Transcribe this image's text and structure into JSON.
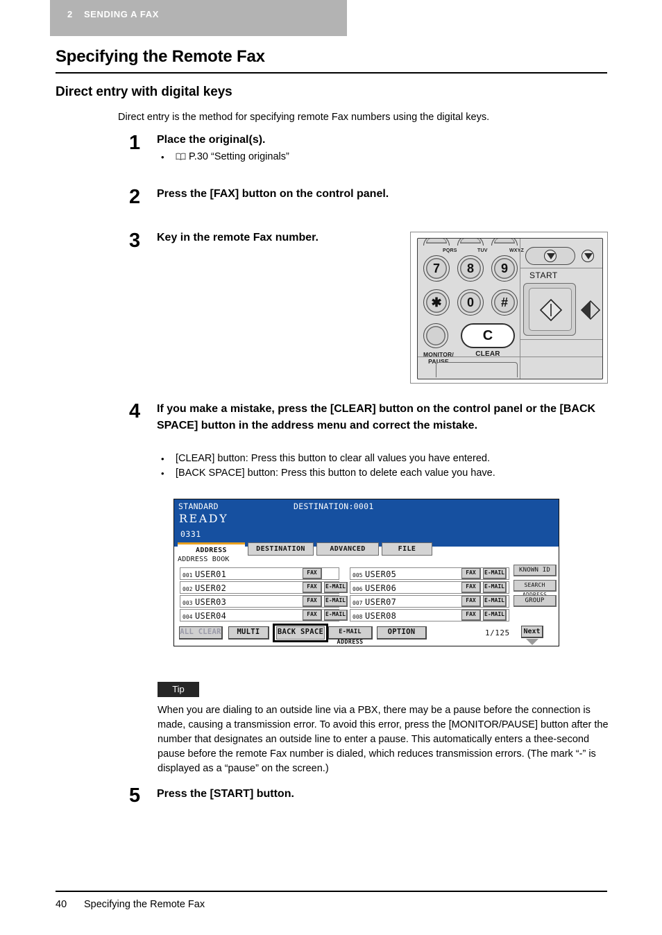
{
  "chapter": {
    "number": "2",
    "title": "SENDING A FAX"
  },
  "headings": {
    "h1": "Specifying the Remote Fax",
    "h2": "Direct entry with digital keys"
  },
  "intro": "Direct entry is the method for specifying remote Fax numbers using the digital keys.",
  "steps": [
    {
      "num": "1",
      "head": "Place the original(s).",
      "bullets": [
        "P.30 “Setting originals”"
      ]
    },
    {
      "num": "2",
      "head": "Press the [FAX] button on the control panel.",
      "bullets": []
    },
    {
      "num": "3",
      "head": "Key in the remote Fax number.",
      "bullets": []
    },
    {
      "num": "4",
      "head": "If you make a mistake, press the [CLEAR] button on the control panel or the [BACK SPACE] button in the address menu and correct the mistake.",
      "bullets": [
        "[CLEAR] button: Press this button to clear all values you have entered.",
        "[BACK SPACE] button: Press this button to delete each value you have."
      ]
    },
    {
      "num": "5",
      "head": "Press the [START] button.",
      "bullets": []
    }
  ],
  "control_panel": {
    "keys": [
      {
        "label": "7",
        "letters": "PQRS"
      },
      {
        "label": "8",
        "letters": "TUV"
      },
      {
        "label": "9",
        "letters": "WXYZ"
      },
      {
        "label": "✱",
        "letters": ""
      },
      {
        "label": "0",
        "letters": ""
      },
      {
        "label": "#",
        "letters": ""
      }
    ],
    "clear_key_label": "C",
    "clear_label": "CLEAR",
    "monitor_label_line1": "MONITOR/",
    "monitor_label_line2": "PAUSE",
    "start_label": "START"
  },
  "lcd": {
    "mode": "STANDARD",
    "destination": "DESTINATION:0001",
    "status": "READY",
    "entered_number": "0331",
    "tabs": [
      {
        "label": "ADDRESS",
        "active": true
      },
      {
        "label": "DESTINATION",
        "active": false
      },
      {
        "label": "ADVANCED",
        "active": false
      },
      {
        "label": "FILE",
        "active": false
      }
    ],
    "address_book_label": "ADDRESS BOOK",
    "entries": [
      {
        "index": "001",
        "name": "USER01",
        "fax": "FAX",
        "email": ""
      },
      {
        "index": "002",
        "name": "USER02",
        "fax": "FAX",
        "email": "E-MAIL"
      },
      {
        "index": "003",
        "name": "USER03",
        "fax": "FAX",
        "email": "E-MAIL"
      },
      {
        "index": "004",
        "name": "USER04",
        "fax": "FAX",
        "email": "E-MAIL"
      },
      {
        "index": "005",
        "name": "USER05",
        "fax": "FAX",
        "email": "E-MAIL"
      },
      {
        "index": "006",
        "name": "USER06",
        "fax": "FAX",
        "email": "E-MAIL"
      },
      {
        "index": "007",
        "name": "USER07",
        "fax": "FAX",
        "email": "E-MAIL"
      },
      {
        "index": "008",
        "name": "USER08",
        "fax": "FAX",
        "email": "E-MAIL"
      }
    ],
    "side_buttons": [
      {
        "label": "KNOWN ID"
      },
      {
        "label": "SEARCH ADDRESS"
      },
      {
        "label": "GROUP"
      }
    ],
    "toolbar": [
      {
        "label": "ALL CLEAR",
        "disabled": true
      },
      {
        "label": "MULTI",
        "disabled": false
      },
      {
        "label": "BACK SPACE",
        "disabled": false,
        "highlighted": true
      },
      {
        "label": "E-MAIL ADDRESS",
        "disabled": false
      },
      {
        "label": "OPTION",
        "disabled": false
      }
    ],
    "page_count": "1/125",
    "next_label": "Next",
    "accent_color": "#e8a020",
    "header_color": "#1650a0"
  },
  "tip": {
    "badge": "Tip",
    "text": "When you are dialing to an outside line via a PBX, there may be a pause before the connection is made, causing a transmission error. To avoid this error, press the [MONITOR/PAUSE] button after the number that designates an outside line to enter a pause. This automatically enters a thee-second pause before the remote Fax number is dialed, which reduces transmission errors. (The mark “-” is displayed as a “pause” on the screen.)"
  },
  "footer": {
    "page_number": "40",
    "title": "Specifying the Remote Fax"
  }
}
